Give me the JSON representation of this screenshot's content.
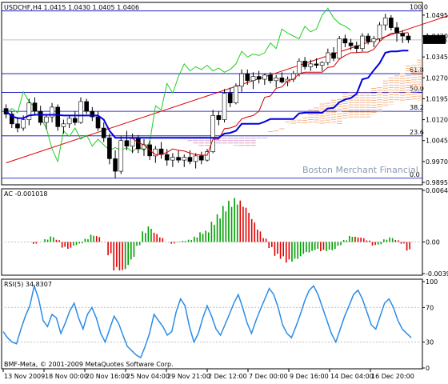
{
  "chart_data": [
    {
      "type": "candlestick",
      "title": "USDCHF,H4  1.0415 1.0430 1.0405 1.0406",
      "watermark": "Boston Merchant Financial",
      "last_price_label": "1.0406",
      "ylim": [
        0.9895,
        1.0532
      ],
      "price_ticks": [
        "1.0495",
        "1.0420",
        "1.0345",
        "1.0270",
        "1.0195",
        "1.0120",
        "1.0045",
        "0.9970",
        "0.9895"
      ],
      "fibonacci": [
        {
          "label": "100.0",
          "price": 1.051
        },
        {
          "label": "61.8",
          "price": 1.0285
        },
        {
          "label": "50.0",
          "price": 1.0218
        },
        {
          "label": "38.2",
          "price": 1.015
        },
        {
          "label": "23.6",
          "price": 1.0062
        },
        {
          "label": "0.0",
          "price": 0.991
        }
      ],
      "trendline": {
        "from": [
          0,
          0.9965
        ],
        "to": [
          79,
          1.0507
        ]
      },
      "candles": [
        [
          1.016,
          1.0175,
          1.0125,
          1.014
        ],
        [
          1.014,
          1.015,
          1.009,
          1.0105
        ],
        [
          1.0105,
          1.013,
          1.0075,
          1.009
        ],
        [
          1.009,
          1.0135,
          1.008,
          1.012
        ],
        [
          1.012,
          1.0195,
          1.01,
          1.018
        ],
        [
          1.018,
          1.02,
          1.014,
          1.015
        ],
        [
          1.015,
          1.017,
          1.01,
          1.011
        ],
        [
          1.011,
          1.014,
          1.0085,
          1.013
        ],
        [
          1.013,
          1.018,
          1.011,
          1.0165
        ],
        [
          1.0165,
          1.0175,
          1.008,
          1.0095
        ],
        [
          1.0095,
          1.012,
          1.007,
          1.0105
        ],
        [
          1.0105,
          1.0135,
          1.009,
          1.0125
        ],
        [
          1.0125,
          1.015,
          1.01,
          1.011
        ],
        [
          1.011,
          1.02,
          1.0105,
          1.0185
        ],
        [
          1.0185,
          1.0195,
          1.014,
          1.015
        ],
        [
          1.015,
          1.0165,
          1.0115,
          1.013
        ],
        [
          1.013,
          1.015,
          1.008,
          1.009
        ],
        [
          1.009,
          1.011,
          1.004,
          1.0055
        ],
        [
          1.0055,
          1.007,
          0.996,
          0.998
        ],
        [
          0.998,
          1.001,
          0.991,
          0.9935
        ],
        [
          0.9935,
          1.006,
          0.9925,
          1.0045
        ],
        [
          1.0045,
          1.008,
          1.001,
          1.0025
        ],
        [
          1.0025,
          1.007,
          1.0,
          1.0055
        ],
        [
          1.0055,
          1.0065,
          1.0,
          1.0015
        ],
        [
          1.0015,
          1.005,
          0.999,
          1.003
        ],
        [
          1.003,
          1.0045,
          0.9975,
          0.999
        ],
        [
          0.999,
          1.0025,
          0.9965,
          1.0015
        ],
        [
          1.0015,
          1.004,
          0.998,
          0.9995
        ],
        [
          0.9995,
          1.0015,
          0.9955,
          0.9975
        ],
        [
          0.9975,
          1.0,
          0.995,
          0.9985
        ],
        [
          0.9985,
          1.001,
          0.9965,
          0.9975
        ],
        [
          0.9975,
          0.9995,
          0.995,
          0.9985
        ],
        [
          0.9985,
          1.001,
          0.996,
          0.997
        ],
        [
          0.997,
          1.0,
          0.9945,
          0.999
        ],
        [
          0.999,
          1.0005,
          0.996,
          0.9975
        ],
        [
          0.9975,
          1.0015,
          0.997,
          1.0005
        ],
        [
          1.0005,
          1.0155,
          1.0,
          1.0135
        ],
        [
          1.0135,
          1.015,
          1.01,
          1.012
        ],
        [
          1.012,
          1.023,
          1.011,
          1.0215
        ],
        [
          1.0215,
          1.0235,
          1.0165,
          1.018
        ],
        [
          1.018,
          1.025,
          1.0175,
          1.024
        ],
        [
          1.024,
          1.03,
          1.022,
          1.0285
        ],
        [
          1.0285,
          1.03,
          1.0245,
          1.026
        ],
        [
          1.026,
          1.029,
          1.023,
          1.0275
        ],
        [
          1.0275,
          1.0295,
          1.025,
          1.0265
        ],
        [
          1.0265,
          1.0285,
          1.0245,
          1.028
        ],
        [
          1.028,
          1.029,
          1.025,
          1.026
        ],
        [
          1.026,
          1.028,
          1.0235,
          1.027
        ],
        [
          1.027,
          1.029,
          1.025,
          1.0255
        ],
        [
          1.0255,
          1.0275,
          1.024,
          1.0265
        ],
        [
          1.0265,
          1.0295,
          1.0255,
          1.0285
        ],
        [
          1.0285,
          1.034,
          1.0275,
          1.033
        ],
        [
          1.033,
          1.0345,
          1.03,
          1.031
        ],
        [
          1.031,
          1.0335,
          1.0295,
          1.032
        ],
        [
          1.032,
          1.034,
          1.0305,
          1.0315
        ],
        [
          1.0315,
          1.033,
          1.0295,
          1.0325
        ],
        [
          1.0325,
          1.0375,
          1.0315,
          1.036
        ],
        [
          1.036,
          1.038,
          1.033,
          1.034
        ],
        [
          1.034,
          1.042,
          1.0335,
          1.041
        ],
        [
          1.041,
          1.0425,
          1.038,
          1.0395
        ],
        [
          1.0395,
          1.041,
          1.037,
          1.0385
        ],
        [
          1.0385,
          1.04,
          1.036,
          1.0375
        ],
        [
          1.0375,
          1.043,
          1.0365,
          1.042
        ],
        [
          1.042,
          1.043,
          1.039,
          1.04
        ],
        [
          1.04,
          1.042,
          1.038,
          1.041
        ],
        [
          1.041,
          1.047,
          1.04,
          1.046
        ],
        [
          1.046,
          1.05,
          1.044,
          1.0485
        ],
        [
          1.0485,
          1.0495,
          1.044,
          1.045
        ],
        [
          1.045,
          1.047,
          1.04,
          1.043
        ],
        [
          1.043,
          1.044,
          1.0395,
          1.042
        ],
        [
          1.042,
          1.043,
          1.0395,
          1.0406
        ]
      ],
      "ac_panel": {
        "label": "AC -0.001018",
        "ticks": [
          "0.00644",
          "0.00",
          "-0.00395"
        ],
        "ylim": [
          -0.00395,
          0.00644
        ]
      },
      "rsi_panel": {
        "label": "RSI(5) 34.8307",
        "ticks": [
          "100",
          "70",
          "30",
          "0"
        ],
        "ylim": [
          0,
          100
        ],
        "values": [
          42,
          35,
          30,
          28,
          45,
          60,
          72,
          95,
          80,
          55,
          48,
          62,
          58,
          40,
          52,
          66,
          75,
          58,
          45,
          62,
          70,
          58,
          40,
          30,
          45,
          60,
          52,
          38,
          25,
          20,
          15,
          12,
          25,
          40,
          62,
          55,
          48,
          38,
          42,
          65,
          80,
          72,
          48,
          30,
          40,
          58,
          72,
          60,
          45,
          38,
          50,
          62,
          75,
          85,
          70,
          52,
          40,
          55,
          68,
          80,
          92,
          85,
          70,
          50,
          40,
          35,
          48,
          62,
          78,
          90,
          95,
          85,
          70,
          55,
          40,
          30,
          45,
          60,
          72,
          85,
          90,
          80,
          65,
          50,
          45,
          60,
          75,
          80,
          70,
          55,
          45,
          40,
          35
        ]
      },
      "time_labels": [
        "13 Nov 2009",
        "18 Nov 00:00",
        "20 Nov 16:00",
        "25 Nov 04:00",
        "29 Nov 21:00",
        "2 Dec 12:00",
        "7 Dec 00:00",
        "9 Dec 16:00",
        "14 Dec 04:00",
        "16 Dec 20:00"
      ],
      "copyright": "BMF-Meta, © 2001-2009 MetaQuotes Software Corp."
    }
  ]
}
